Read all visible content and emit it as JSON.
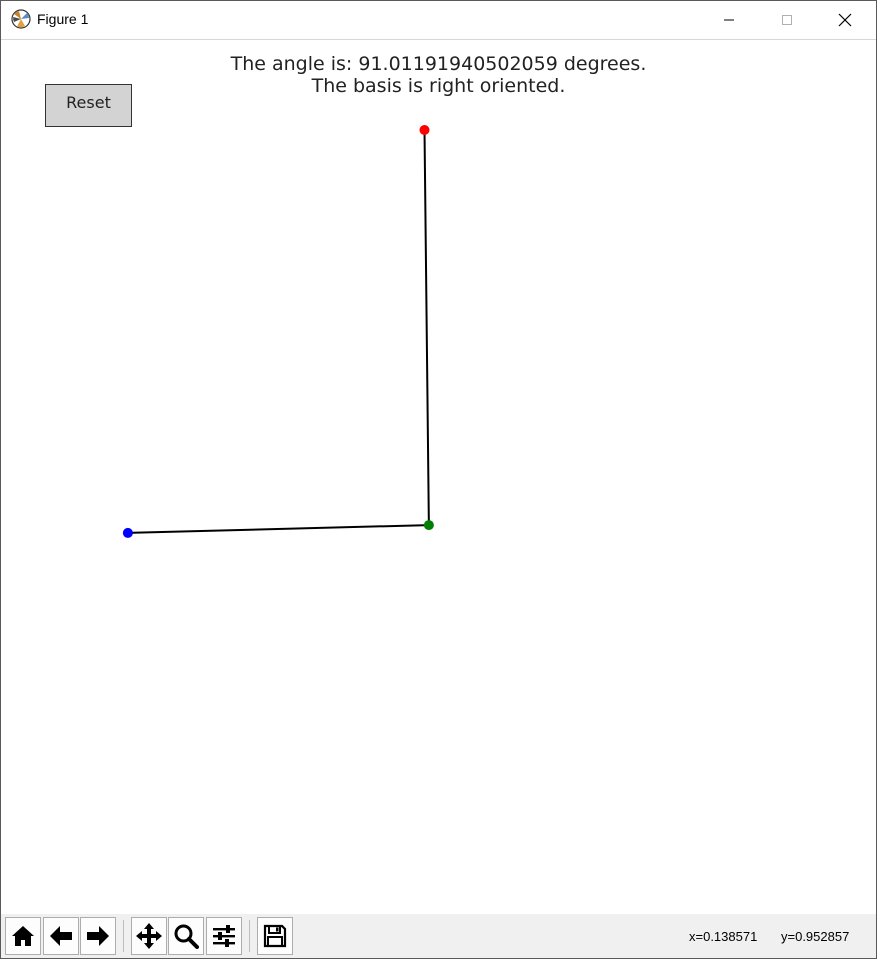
{
  "window": {
    "title": "Figure 1"
  },
  "figure": {
    "angle_text": "The angle is: 91.01191940502059 degrees.",
    "orientation_text": "The basis is right oriented.",
    "reset_label": "Reset"
  },
  "chart_data": {
    "type": "scatter",
    "points": [
      {
        "name": "origin",
        "x": 0.489,
        "y": 0.445,
        "color": "#008000"
      },
      {
        "name": "vector-a-tip",
        "x": 0.145,
        "y": 0.436,
        "color": "#0000ff"
      },
      {
        "name": "vector-b-tip",
        "x": 0.484,
        "y": 0.897,
        "color": "#ff0000"
      }
    ],
    "xlim": [
      0,
      1
    ],
    "ylim": [
      0,
      1
    ],
    "grid": false
  },
  "toolbar": {
    "icons": [
      "home-icon",
      "back-icon",
      "forward-icon",
      "pan-icon",
      "zoom-icon",
      "configure-subplots-icon",
      "save-icon"
    ],
    "coord_x": "x=0.138571",
    "coord_y": "y=0.952857"
  }
}
